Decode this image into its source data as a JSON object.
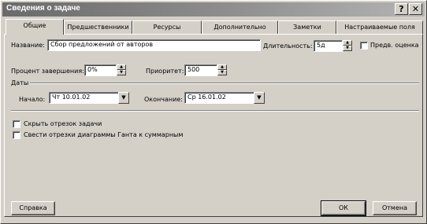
{
  "window": {
    "title": "Сведения о задаче",
    "help_label": "?",
    "close_label": "✕"
  },
  "tabs": [
    {
      "label": "Общие",
      "active": true
    },
    {
      "label": "Предшественники"
    },
    {
      "label": "Ресурсы"
    },
    {
      "label": "Дополнительно"
    },
    {
      "label": "Заметки"
    },
    {
      "label": "Настраиваемые поля"
    }
  ],
  "general": {
    "name_label": "Название:",
    "name_value": "Сбор предложений от авторов",
    "duration_label": "Длительность:",
    "duration_value": "5д",
    "estimated_label": "Предв. оценка",
    "estimated_checked": false,
    "percent_label": "Процент завершения:",
    "percent_value": "0%",
    "priority_label": "Приоритет:",
    "priority_value": "500",
    "dates_label": "Даты",
    "start_label": "Начало:",
    "start_value": "Чт 10.01.02",
    "finish_label": "Окончание:",
    "finish_value": "Ср 16.01.02",
    "hide_bar_label": "Скрыть отрезок задачи",
    "hide_bar_checked": false,
    "rollup_label": "Свести отрезки диаграммы Ганта к суммарным",
    "rollup_checked": false
  },
  "buttons": {
    "help": "Справка",
    "ok": "ОК",
    "cancel": "Отмена"
  },
  "icons": {
    "spin_up": "▲",
    "spin_down": "▼",
    "dropdown": "▼"
  }
}
